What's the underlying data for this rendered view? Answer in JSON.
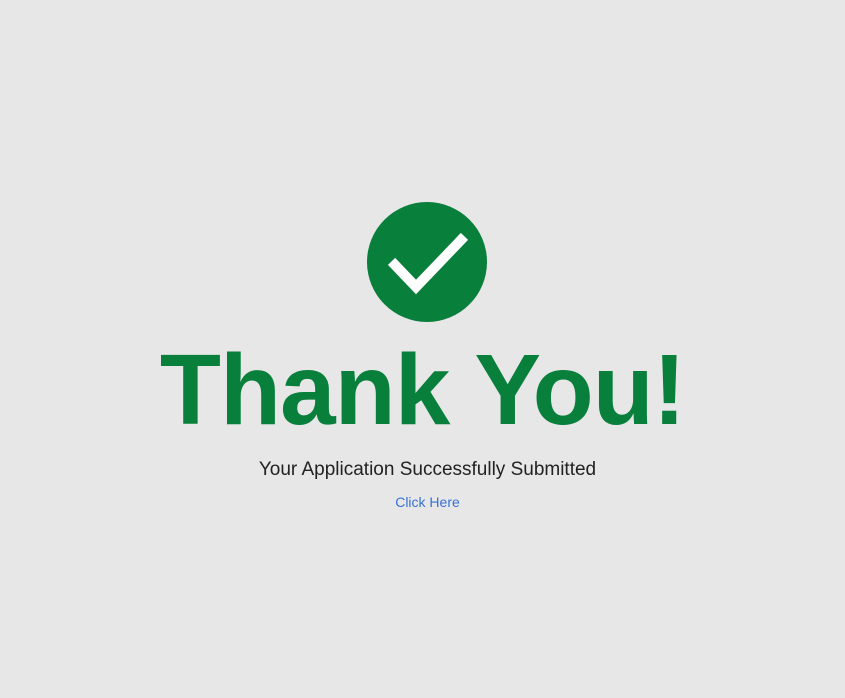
{
  "confirmation": {
    "icon": "checkmark-circle-icon",
    "headline": "Thank You!",
    "message": "Your Application Successfully Submitted",
    "link_label": "Click Here"
  },
  "colors": {
    "background": "#e7e7e7",
    "accent_green": "#087f3b",
    "message_text": "#222222",
    "link": "#3a70d6"
  }
}
